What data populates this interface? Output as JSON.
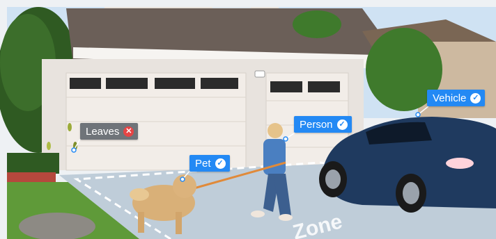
{
  "tags": {
    "leaves": {
      "label": "Leaves",
      "status": "rejected",
      "icon": "x-circle-icon"
    },
    "person": {
      "label": "Person",
      "status": "detected",
      "icon": "check-circle-icon"
    },
    "pet": {
      "label": "Pet",
      "status": "detected",
      "icon": "check-circle-icon"
    },
    "vehicle": {
      "label": "Vehicle",
      "status": "detected",
      "icon": "check-circle-icon"
    }
  },
  "zone": {
    "label": "Zone"
  },
  "colors": {
    "accent": "#2389f4",
    "rejected": "#e64545",
    "neutral_tag": "#6f7479"
  }
}
